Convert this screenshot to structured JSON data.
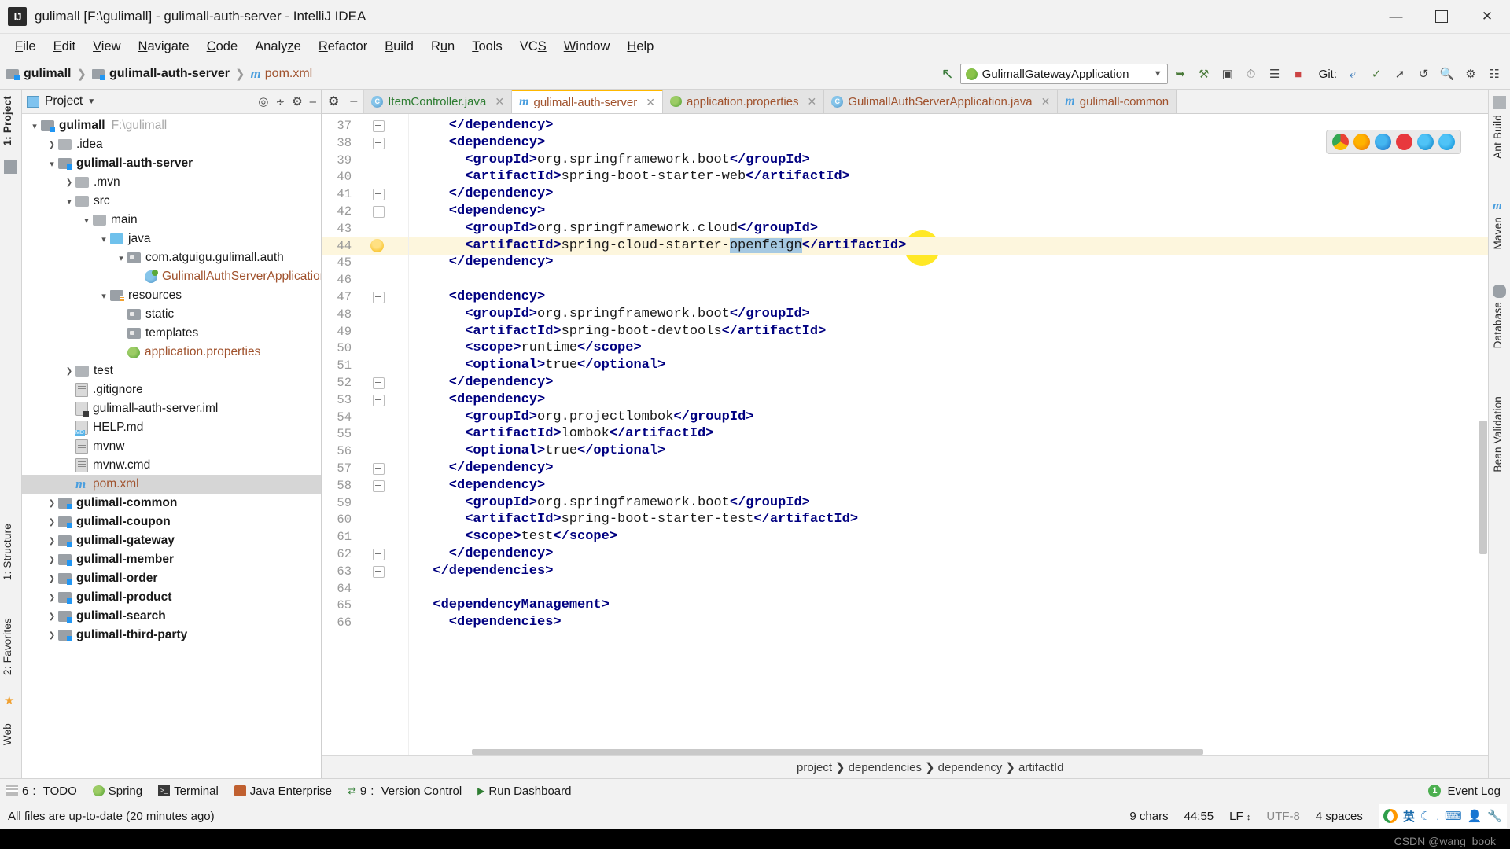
{
  "window": {
    "title": "gulimall [F:\\gulimall] - gulimall-auth-server - IntelliJ IDEA",
    "logo": "IJ",
    "minimize": "—",
    "maximize": "☐",
    "close": "✕"
  },
  "menubar": [
    "File",
    "Edit",
    "View",
    "Navigate",
    "Code",
    "Analyze",
    "Refactor",
    "Build",
    "Run",
    "Tools",
    "VCS",
    "Window",
    "Help"
  ],
  "navbar": {
    "crumbs": [
      {
        "label": "gulimall",
        "type": "module"
      },
      {
        "label": "gulimall-auth-server",
        "type": "module"
      },
      {
        "label": "pom.xml",
        "type": "maven-file"
      }
    ],
    "back_icon": "↖",
    "run_config": "GulimallGatewayApplication",
    "git_label": "Git:",
    "toolbar_icons": [
      "run-icon",
      "debug-icon",
      "run-with-coverage-icon",
      "profile-icon",
      "attach-icon",
      "stop-icon"
    ],
    "git_icons": [
      "update-project-icon",
      "commit-icon",
      "push-icon",
      "rollback-icon"
    ],
    "right_icons": [
      "search-everywhere-icon",
      "settings-icon",
      "layout-icon"
    ]
  },
  "left_rail": [
    {
      "label": "1: Project",
      "selected": true
    },
    {
      "label": "1: Structure",
      "selected": false
    },
    {
      "label": "2: Favorites",
      "selected": false
    },
    {
      "label": "Web",
      "selected": false
    }
  ],
  "right_rail": [
    {
      "label": "Ant Build"
    },
    {
      "label": "Maven"
    },
    {
      "label": "Database"
    },
    {
      "label": "Bean Validation"
    }
  ],
  "project_panel": {
    "header": "Project",
    "actions": [
      "locate-icon",
      "collapse-all-icon",
      "settings-icon",
      "hide-icon"
    ],
    "tree": [
      {
        "depth": 0,
        "arrow": "expanded",
        "icon": "module-folder",
        "label": "gulimall",
        "bold": true,
        "path": "F:\\gulimall"
      },
      {
        "depth": 1,
        "arrow": "collapsed",
        "icon": "folder",
        "label": ".idea",
        "bold": false
      },
      {
        "depth": 1,
        "arrow": "expanded",
        "icon": "module-folder",
        "label": "gulimall-auth-server",
        "bold": true
      },
      {
        "depth": 2,
        "arrow": "collapsed",
        "icon": "folder",
        "label": ".mvn",
        "bold": false
      },
      {
        "depth": 2,
        "arrow": "expanded",
        "icon": "folder",
        "label": "src",
        "bold": false
      },
      {
        "depth": 3,
        "arrow": "expanded",
        "icon": "folder",
        "label": "main",
        "bold": false
      },
      {
        "depth": 4,
        "arrow": "expanded",
        "icon": "source-folder",
        "label": "java",
        "bold": false
      },
      {
        "depth": 5,
        "arrow": "expanded",
        "icon": "package",
        "label": "com.atguigu.gulimall.auth",
        "bold": false
      },
      {
        "depth": 6,
        "arrow": "none",
        "icon": "spring-class",
        "label": "GulimallAuthServerApplication",
        "color": "orange"
      },
      {
        "depth": 4,
        "arrow": "expanded",
        "icon": "resource-folder",
        "label": "resources",
        "bold": false
      },
      {
        "depth": 5,
        "arrow": "none",
        "icon": "package",
        "label": "static",
        "bold": false
      },
      {
        "depth": 5,
        "arrow": "none",
        "icon": "package",
        "label": "templates",
        "bold": false
      },
      {
        "depth": 5,
        "arrow": "none",
        "icon": "spring-props",
        "label": "application.properties",
        "color": "orange"
      },
      {
        "depth": 2,
        "arrow": "collapsed",
        "icon": "folder",
        "label": "test",
        "bold": false
      },
      {
        "depth": 2,
        "arrow": "none",
        "icon": "file",
        "label": ".gitignore",
        "bold": false
      },
      {
        "depth": 2,
        "arrow": "none",
        "icon": "iml-file",
        "label": "gulimall-auth-server.iml",
        "bold": false
      },
      {
        "depth": 2,
        "arrow": "none",
        "icon": "md-file",
        "label": "HELP.md",
        "bold": false
      },
      {
        "depth": 2,
        "arrow": "none",
        "icon": "file",
        "label": "mvnw",
        "bold": false
      },
      {
        "depth": 2,
        "arrow": "none",
        "icon": "file",
        "label": "mvnw.cmd",
        "bold": false
      },
      {
        "depth": 2,
        "arrow": "none",
        "icon": "maven-file",
        "label": "pom.xml",
        "color": "orange",
        "selected": true
      },
      {
        "depth": 1,
        "arrow": "collapsed",
        "icon": "module-folder",
        "label": "gulimall-common",
        "bold": true
      },
      {
        "depth": 1,
        "arrow": "collapsed",
        "icon": "module-folder",
        "label": "gulimall-coupon",
        "bold": true
      },
      {
        "depth": 1,
        "arrow": "collapsed",
        "icon": "module-folder",
        "label": "gulimall-gateway",
        "bold": true
      },
      {
        "depth": 1,
        "arrow": "collapsed",
        "icon": "module-folder",
        "label": "gulimall-member",
        "bold": true
      },
      {
        "depth": 1,
        "arrow": "collapsed",
        "icon": "module-folder",
        "label": "gulimall-order",
        "bold": true
      },
      {
        "depth": 1,
        "arrow": "collapsed",
        "icon": "module-folder",
        "label": "gulimall-product",
        "bold": true
      },
      {
        "depth": 1,
        "arrow": "collapsed",
        "icon": "module-folder",
        "label": "gulimall-search",
        "bold": true
      },
      {
        "depth": 1,
        "arrow": "collapsed",
        "icon": "module-folder",
        "label": "gulimall-third-party",
        "bold": true
      }
    ]
  },
  "editor": {
    "tools": [
      "settings-icon",
      "hide-icon"
    ],
    "tabs": [
      {
        "label": "ItemController.java",
        "icon": "java-class-icon",
        "color": "green",
        "active": false,
        "closable": true
      },
      {
        "label": "gulimall-auth-server",
        "icon": "maven-icon",
        "color": "orange",
        "active": true,
        "closable": true
      },
      {
        "label": "application.properties",
        "icon": "spring-props-icon",
        "color": "orange",
        "active": false,
        "closable": true
      },
      {
        "label": "GulimallAuthServerApplication.java",
        "icon": "spring-class-icon",
        "color": "orange",
        "active": false,
        "closable": true
      },
      {
        "label": "gulimall-common",
        "icon": "maven-icon",
        "color": "orange",
        "active": false,
        "closable": false
      }
    ],
    "first_line_number": 37,
    "highlighted_line": 44,
    "selected_text": "openfeign",
    "lines": [
      {
        "n": 37,
        "indent": 4,
        "text": "</dependency>",
        "fold": "end"
      },
      {
        "n": 38,
        "indent": 4,
        "text": "<dependency>",
        "fold": "start"
      },
      {
        "n": 39,
        "indent": 6,
        "text": "<groupId>org.springframework.boot</groupId>"
      },
      {
        "n": 40,
        "indent": 6,
        "text": "<artifactId>spring-boot-starter-web</artifactId>"
      },
      {
        "n": 41,
        "indent": 4,
        "text": "</dependency>",
        "fold": "end"
      },
      {
        "n": 42,
        "indent": 4,
        "text": "<dependency>",
        "fold": "start"
      },
      {
        "n": 43,
        "indent": 6,
        "text": "<groupId>org.springframework.cloud</groupId>"
      },
      {
        "n": 44,
        "indent": 6,
        "text": "<artifactId>spring-cloud-starter-openfeign</artifactId>",
        "bulb": true
      },
      {
        "n": 45,
        "indent": 4,
        "text": "</dependency>"
      },
      {
        "n": 46,
        "indent": 0,
        "text": ""
      },
      {
        "n": 47,
        "indent": 4,
        "text": "<dependency>",
        "fold": "start"
      },
      {
        "n": 48,
        "indent": 6,
        "text": "<groupId>org.springframework.boot</groupId>"
      },
      {
        "n": 49,
        "indent": 6,
        "text": "<artifactId>spring-boot-devtools</artifactId>"
      },
      {
        "n": 50,
        "indent": 6,
        "text": "<scope>runtime</scope>"
      },
      {
        "n": 51,
        "indent": 6,
        "text": "<optional>true</optional>"
      },
      {
        "n": 52,
        "indent": 4,
        "text": "</dependency>",
        "fold": "end"
      },
      {
        "n": 53,
        "indent": 4,
        "text": "<dependency>",
        "fold": "start"
      },
      {
        "n": 54,
        "indent": 6,
        "text": "<groupId>org.projectlombok</groupId>"
      },
      {
        "n": 55,
        "indent": 6,
        "text": "<artifactId>lombok</artifactId>"
      },
      {
        "n": 56,
        "indent": 6,
        "text": "<optional>true</optional>"
      },
      {
        "n": 57,
        "indent": 4,
        "text": "</dependency>",
        "fold": "end"
      },
      {
        "n": 58,
        "indent": 4,
        "text": "<dependency>",
        "fold": "start"
      },
      {
        "n": 59,
        "indent": 6,
        "text": "<groupId>org.springframework.boot</groupId>"
      },
      {
        "n": 60,
        "indent": 6,
        "text": "<artifactId>spring-boot-starter-test</artifactId>"
      },
      {
        "n": 61,
        "indent": 6,
        "text": "<scope>test</scope>"
      },
      {
        "n": 62,
        "indent": 4,
        "text": "</dependency>",
        "fold": "end"
      },
      {
        "n": 63,
        "indent": 2,
        "text": "</dependencies>",
        "fold": "end"
      },
      {
        "n": 64,
        "indent": 0,
        "text": ""
      },
      {
        "n": 65,
        "indent": 2,
        "text": "<dependencyManagement>"
      },
      {
        "n": 66,
        "indent": 4,
        "text": "<dependencies>"
      }
    ],
    "structure_breadcrumb": [
      "project",
      "dependencies",
      "dependency",
      "artifactId"
    ]
  },
  "tool_windows": [
    {
      "num": "6",
      "label": "TODO",
      "icon": "todo-icon"
    },
    {
      "num": "",
      "label": "Spring",
      "icon": "spring-icon"
    },
    {
      "num": "",
      "label": "Terminal",
      "icon": "terminal-icon"
    },
    {
      "num": "",
      "label": "Java Enterprise",
      "icon": "java-enterprise-icon"
    },
    {
      "num": "9",
      "label": "Version Control",
      "icon": "vcs-icon"
    },
    {
      "num": "",
      "label": "Run Dashboard",
      "icon": "run-dashboard-icon"
    }
  ],
  "event_log": {
    "label": "Event Log",
    "count": "1"
  },
  "statusbar": {
    "message": "All files are up-to-date (20 minutes ago)",
    "chars": "9 chars",
    "position": "44:55",
    "line_separator": "LF",
    "encoding": "UTF-8",
    "indent": "4 spaces",
    "ime_lang": "英",
    "ime_icons": [
      "sogou-icon",
      "lang-icon",
      "moon-icon",
      "punctuation-icon",
      "keyboard-icon",
      "user-icon",
      "tools-icon"
    ]
  },
  "watermark": "CSDN @wang_book"
}
